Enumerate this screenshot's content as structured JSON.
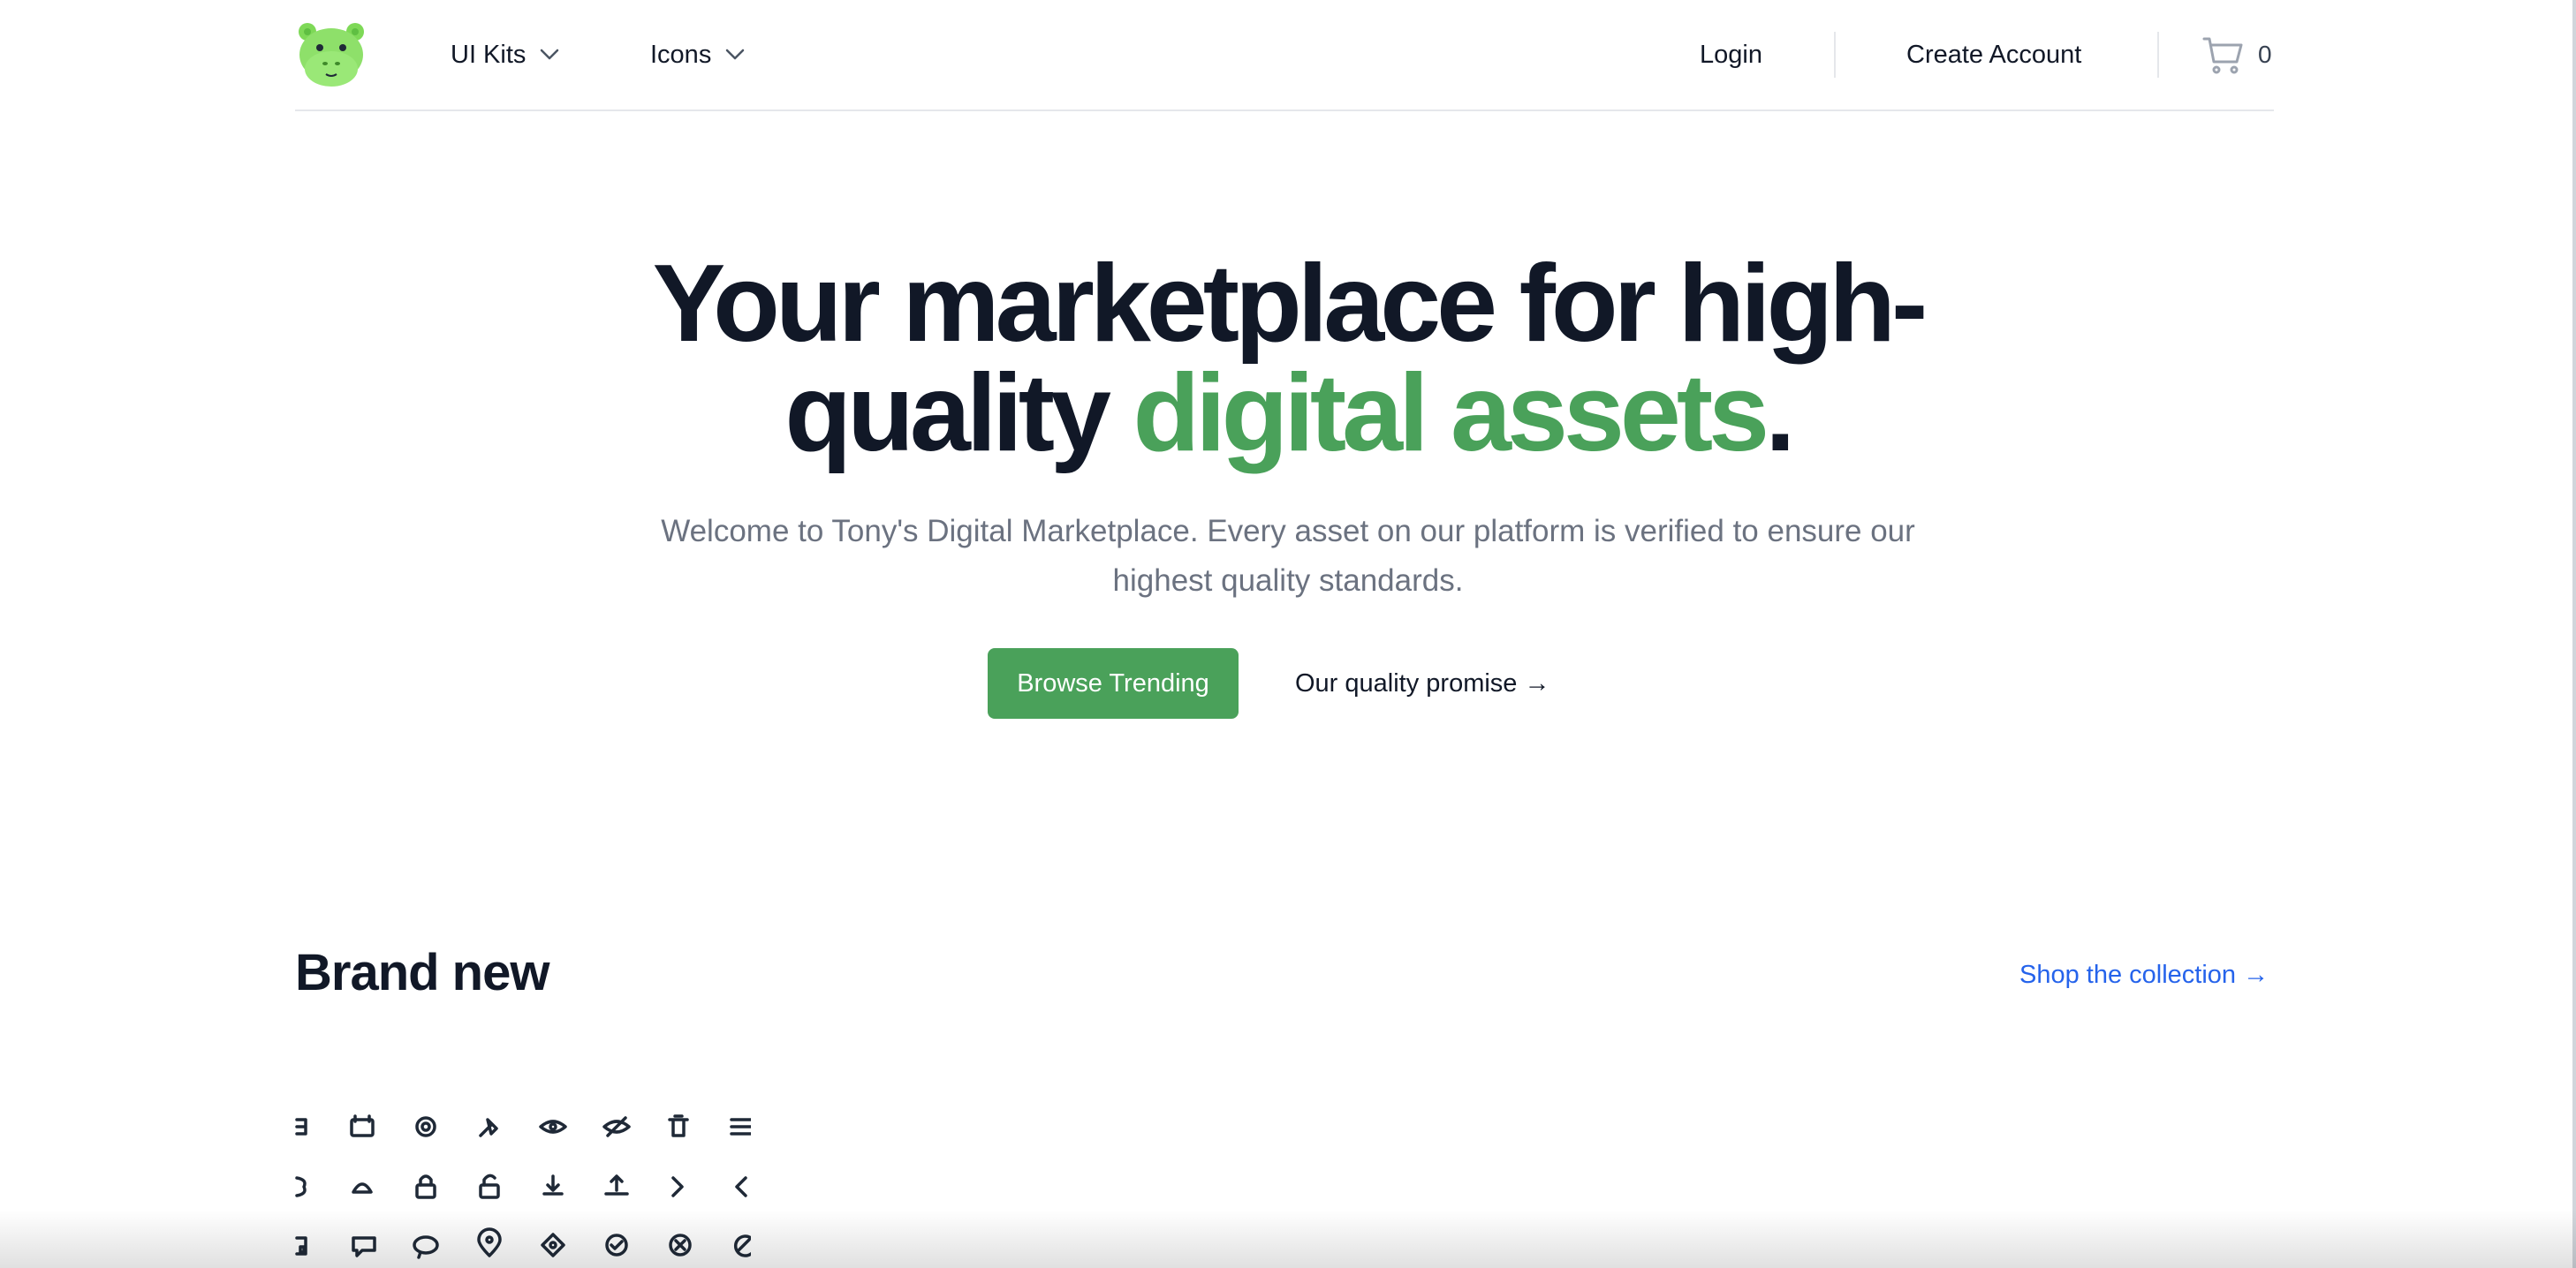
{
  "header": {
    "logo_icon": "hippo-logo-icon",
    "nav": [
      {
        "label": "UI Kits",
        "icon": "chevron-down-icon"
      },
      {
        "label": "Icons",
        "icon": "chevron-down-icon"
      }
    ],
    "login_label": "Login",
    "create_account_label": "Create Account",
    "cart": {
      "icon": "shopping-cart-icon",
      "count": "0"
    }
  },
  "hero": {
    "title_part1": "Your marketplace for high-",
    "title_part2": "quality ",
    "title_accent": "digital assets",
    "title_end": ".",
    "subtitle": "Welcome to Tony's Digital Marketplace. Every asset on our platform is verified to ensure our highest quality standards.",
    "primary_cta": "Browse Trending",
    "secondary_cta": "Our quality promise →"
  },
  "section": {
    "title": "Brand new",
    "link": "Shop the collection →"
  },
  "colors": {
    "accent_green": "#4aa15a",
    "link_blue": "#2563eb",
    "text_dark": "#111827",
    "text_muted": "#6b7280"
  }
}
